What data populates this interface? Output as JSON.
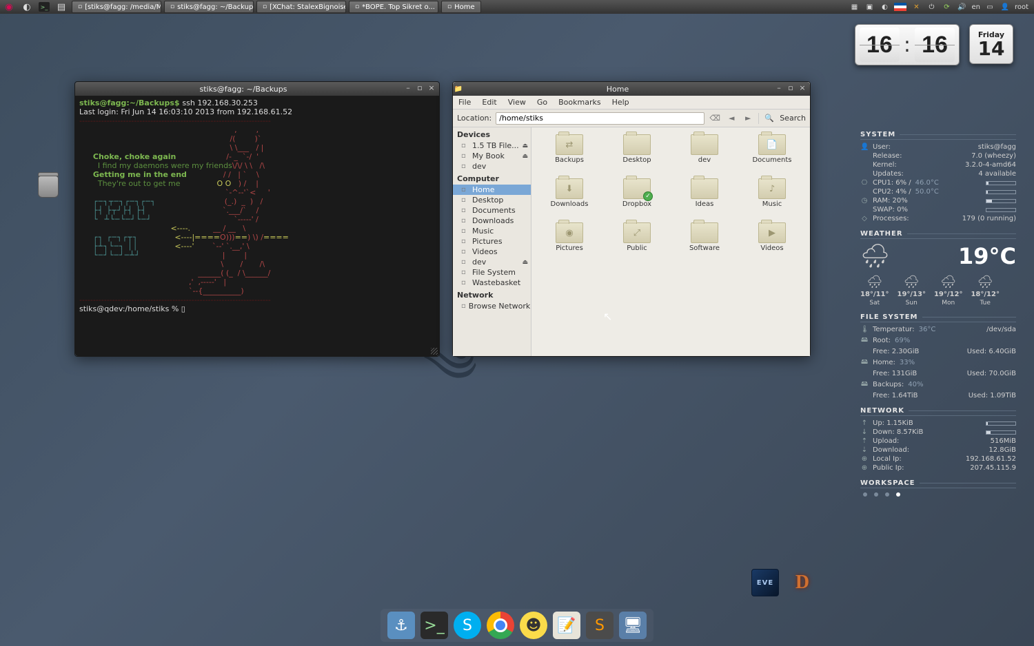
{
  "panel": {
    "tasks": [
      "[stiks@fagg: /media/M...",
      "stiks@fagg: ~/Backups",
      "[XChat: StalexBignoise...",
      "*BOPE. Top Sikret o...",
      "Home"
    ],
    "lang": "en",
    "user": "root"
  },
  "clock": {
    "h": "16",
    "m": "16",
    "dow": "Friday",
    "dom": "14"
  },
  "trash_label": "Trash",
  "terminal": {
    "title": "stiks@fagg: ~/Backups",
    "prompt1": "stiks@fagg:~/Backups$ ",
    "cmd1": "ssh 192.168.30.253",
    "line2": "Last login: Fri Jun 14 16:03:10 2013 from 192.168.61.52",
    "motd1": "Choke, choke again",
    "motd2": "  I find my daemons were my friends",
    "motd3": "Getting me in the end",
    "motd4": "  They're out to get me",
    "big1": "FREE",
    "big2": "BSD",
    "prompt2": "stiks@qdev:/home/stiks % ",
    "cursor": "▯"
  },
  "fm": {
    "title": "Home",
    "menu": [
      "File",
      "Edit",
      "View",
      "Go",
      "Bookmarks",
      "Help"
    ],
    "loc_label": "Location:",
    "loc_value": "/home/stiks",
    "search": "Search",
    "sections": {
      "devices": {
        "title": "Devices",
        "items": [
          "1.5 TB File...",
          "My Book",
          "dev"
        ]
      },
      "computer": {
        "title": "Computer",
        "items": [
          "Home",
          "Desktop",
          "Documents",
          "Downloads",
          "Music",
          "Pictures",
          "Videos",
          "dev",
          "File System",
          "Wastebasket"
        ]
      },
      "network": {
        "title": "Network",
        "items": [
          "Browse Network"
        ]
      }
    },
    "folders": [
      {
        "n": "Backups",
        "s": "⇄"
      },
      {
        "n": "Desktop",
        "s": ""
      },
      {
        "n": "dev",
        "s": ""
      },
      {
        "n": "Documents",
        "s": "📄"
      },
      {
        "n": "Downloads",
        "s": "⬇"
      },
      {
        "n": "Dropbox",
        "s": "",
        "badge": "✓"
      },
      {
        "n": "Ideas",
        "s": ""
      },
      {
        "n": "Music",
        "s": "♪"
      },
      {
        "n": "Pictures",
        "s": "◉"
      },
      {
        "n": "Public",
        "s": "⤢"
      },
      {
        "n": "Software",
        "s": ""
      },
      {
        "n": "Videos",
        "s": "▶"
      }
    ]
  },
  "conky": {
    "system_h": "SYSTEM",
    "user_l": "User:",
    "user_v": "stiks@fagg",
    "rel_l": "Release:",
    "rel_v": "7.0 (wheezy)",
    "ker_l": "Kernel:",
    "ker_v": "3.2.0-4-amd64",
    "upd_l": "Updates:",
    "upd_v": "4 available",
    "cpu1_l": "CPU1: 6% /",
    "cpu1_t": "46.0°C",
    "cpu1_p": 6,
    "cpu2_l": "CPU2: 4% /",
    "cpu2_t": "50.0°C",
    "cpu2_p": 4,
    "ram_l": "RAM: 20%",
    "ram_p": 20,
    "swap_l": "SWAP: 0%",
    "swap_p": 0,
    "proc_l": "Processes:",
    "proc_v": "179 (0 running)",
    "weather_h": "WEATHER",
    "temp": "19°C",
    "days": [
      {
        "t": "18°/11°",
        "d": "Sat"
      },
      {
        "t": "19°/13°",
        "d": "Sun"
      },
      {
        "t": "19°/12°",
        "d": "Mon"
      },
      {
        "t": "18°/12°",
        "d": "Tue"
      }
    ],
    "fs_h": "FILE SYSTEM",
    "ftemp_l": "Temperatur:",
    "ftemp_v": "36°C",
    "ftemp_d": "/dev/sda",
    "root_l": "Root:",
    "root_p": "69%",
    "root_f": "Free: 2.30GiB",
    "root_u": "Used: 6.40GiB",
    "home_l": "Home:",
    "home_p": "33%",
    "home_f": "Free: 131GiB",
    "home_u": "Used: 70.0GiB",
    "bak_l": "Backups:",
    "bak_p": "40%",
    "bak_f": "Free: 1.64TiB",
    "bak_u": "Used: 1.09TiB",
    "net_h": "NETWORK",
    "up_l": "Up: 1.15KiB",
    "dn_l": "Down: 8.57KiB",
    "upl_l": "Upload:",
    "upl_v": "516MiB",
    "dnl_l": "Download:",
    "dnl_v": "12.8GiB",
    "lip_l": "Local Ip:",
    "lip_v": "192.168.61.52",
    "pip_l": "Public Ip:",
    "pip_v": "207.45.115.9",
    "ws_h": "WORKSPACE"
  },
  "shortcuts": {
    "eve": "EVE",
    "diablo": "D"
  }
}
